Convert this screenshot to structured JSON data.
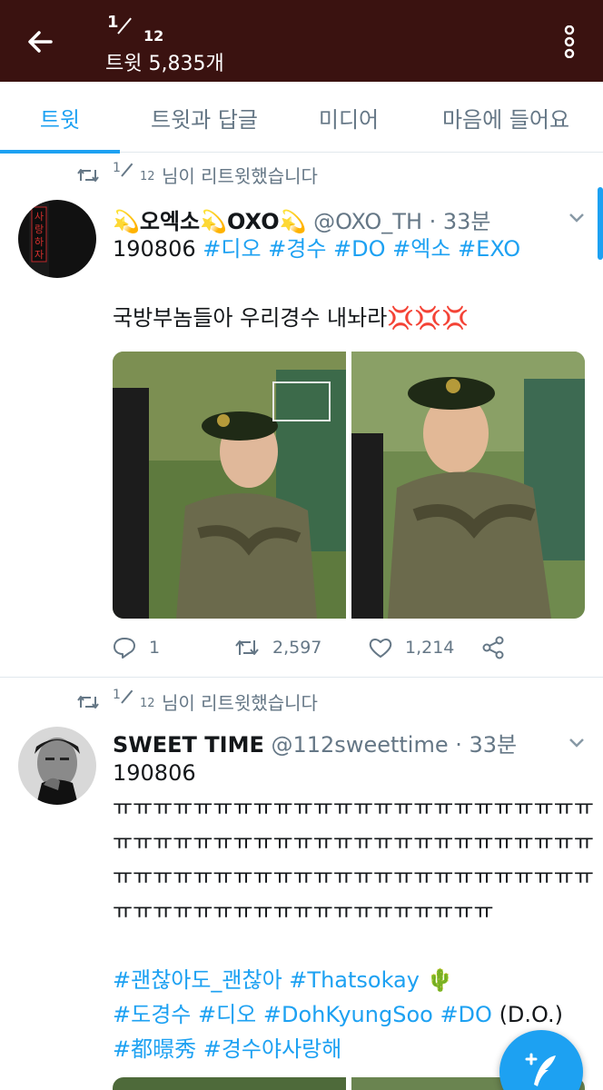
{
  "header": {
    "index_numerator": "1",
    "index_denominator": "12",
    "tweet_count": "트윗 5,835개"
  },
  "tabs": [
    {
      "label": "트윗",
      "active": true
    },
    {
      "label": "트윗과 답글",
      "active": false
    },
    {
      "label": "미디어",
      "active": false
    },
    {
      "label": "마음에 들어요",
      "active": false
    }
  ],
  "tweets": [
    {
      "retweeted_by_num": "1",
      "retweeted_by_den": "12",
      "retweet_text": "님이 리트윗했습니다",
      "display_name": "💫오엑소💫OXO💫",
      "handle_time": "@OXO_TH · 33분",
      "lines": [
        {
          "plain": "190806 ",
          "tags": "#디오 #경수 #DO #엑소 #EXO"
        },
        {
          "plain": "",
          "tags": ""
        },
        {
          "plain": "국방부놈들아 우리경수 내놔라💢💢💢",
          "tags": ""
        }
      ],
      "reply_count": "1",
      "retweet_count": "2,597",
      "like_count": "1,214"
    },
    {
      "retweeted_by_num": "1",
      "retweeted_by_den": "12",
      "retweet_text": "님이 리트윗했습니다",
      "display_name": "SWEET TIME",
      "handle_time": "@112sweettime · 33분",
      "lines": [
        {
          "plain": "190806",
          "tags": ""
        },
        {
          "plain": "ㅠㅠㅠㅠㅠㅠㅠㅠㅠㅠㅠㅠㅠㅠㅠㅠㅠㅠㅠㅠㅠㅠㅠㅠ",
          "tags": ""
        },
        {
          "plain": "ㅠㅠㅠㅠㅠㅠㅠㅠㅠㅠㅠㅠㅠㅠㅠㅠㅠㅠㅠㅠㅠㅠㅠㅠ",
          "tags": ""
        },
        {
          "plain": "ㅠㅠㅠㅠㅠㅠㅠㅠㅠㅠㅠㅠㅠㅠㅠㅠㅠㅠㅠㅠㅠㅠㅠㅠ",
          "tags": ""
        },
        {
          "plain": "ㅠㅠㅠㅠㅠㅠㅠㅠㅠㅠㅠㅠㅠㅠㅠㅠㅠㅠㅠ",
          "tags": ""
        },
        {
          "plain": "",
          "tags": ""
        },
        {
          "plain": "",
          "tags": "#괜찮아도_괜찮아 #Thatsokay 🌵"
        },
        {
          "tags_first": "#도경수 #디오 #DohKyungSoo #DO",
          "plain_after": " (D.O.)"
        },
        {
          "plain": "",
          "tags": "#都暻秀 #경수야사랑해"
        }
      ]
    }
  ],
  "colors": {
    "header_bg": "#3a1210",
    "accent": "#1da1f2",
    "secondary_text": "#657786"
  }
}
